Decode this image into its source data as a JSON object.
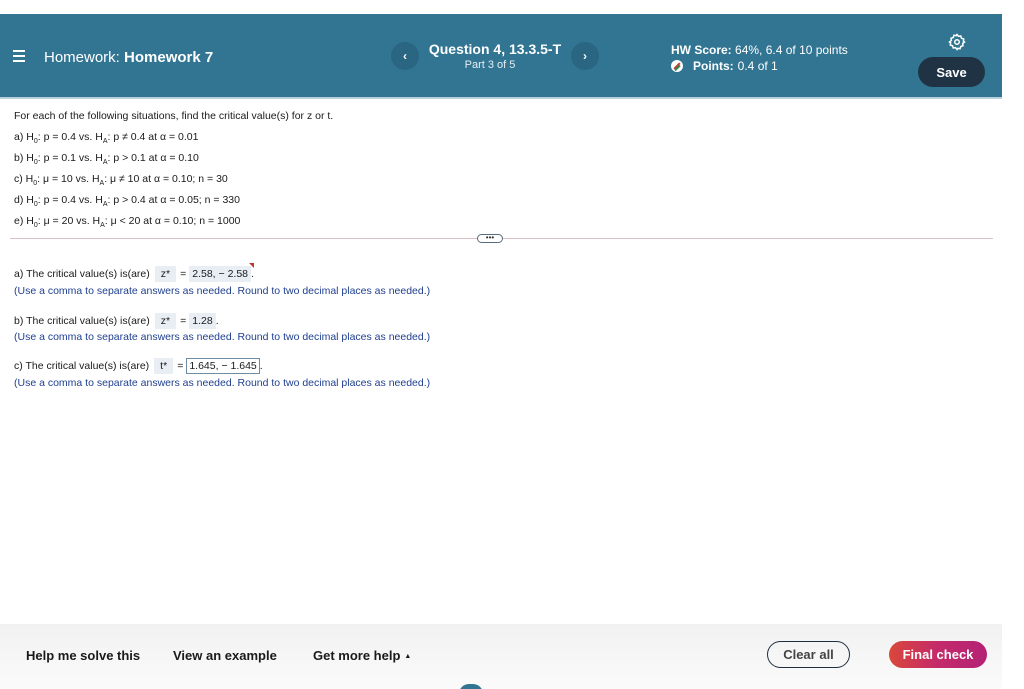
{
  "header": {
    "menu_icon": "hamburger-icon",
    "homework_prefix": "Homework:",
    "homework_name": "Homework 7",
    "question_title": "Question 4, 13.3.5-T",
    "question_part": "Part 3 of 5",
    "prev_icon": "‹",
    "next_icon": "›",
    "hw_score_label": "HW Score:",
    "hw_score_value": "64%, 6.4 of 10 points",
    "points_label": "Points:",
    "points_value": "0.4 of 1",
    "settings_icon": "gear-icon",
    "save_label": "Save",
    "colors": {
      "header_bg": "#317593",
      "save_bg": "#1f3345"
    }
  },
  "question": {
    "intro": "For each of the following situations, find the critical value(s) for z or t.",
    "items": [
      {
        "prefix": "a) H",
        "sub0": "0",
        "h0": ": p = 0.4 vs. H",
        "subA": "A",
        "ha": ": p ≠ 0.4 at α = 0.01"
      },
      {
        "prefix": "b) H",
        "sub0": "0",
        "h0": ": p = 0.1 vs. H",
        "subA": "A",
        "ha": ": p > 0.1 at α = 0.10"
      },
      {
        "prefix": "c) H",
        "sub0": "0",
        "h0": ": μ = 10 vs. H",
        "subA": "A",
        "ha": ": μ ≠ 10 at α = 0.10; n = 30"
      },
      {
        "prefix": "d) H",
        "sub0": "0",
        "h0": ": p = 0.4 vs. H",
        "subA": "A",
        "ha": ": p > 0.4 at α = 0.05; n = 330"
      },
      {
        "prefix": "e) H",
        "sub0": "0",
        "h0": ": μ = 20 vs. H",
        "subA": "A",
        "ha": ": μ < 20 at α = 0.10; n = 1000"
      }
    ],
    "more_label": "•••"
  },
  "answers": [
    {
      "label": "a) The critical value(s) is(are)",
      "var": "z*",
      "eq": "=",
      "value": "2.58, − 2.58",
      "end": ".",
      "hint": "(Use a comma to separate answers as needed. Round to two decimal places as needed.)"
    },
    {
      "label": "b) The critical value(s) is(are)",
      "var": "z*",
      "eq": "=",
      "value": "1.28",
      "end": ".",
      "hint": "(Use a comma to separate answers as needed. Round to two decimal places as needed.)"
    },
    {
      "label": "c) The critical value(s) is(are)",
      "var": "t*",
      "eq": "=",
      "value": "1.645, − 1.645",
      "end": ".",
      "hint": "(Use a comma to separate answers as needed. Round to two decimal places as needed.)"
    }
  ],
  "footer": {
    "help_label": "Help me solve this",
    "example_label": "View an example",
    "more_help_label": "Get more help",
    "more_help_caret": "▲",
    "clear_label": "Clear all",
    "final_label": "Final check"
  }
}
